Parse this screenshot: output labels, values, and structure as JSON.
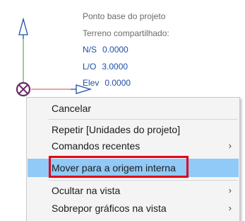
{
  "info": {
    "title": "Ponto base do projeto",
    "subtitle": "Terreno compartilhado:",
    "coords": [
      {
        "label": "N/S",
        "value": "0.0000"
      },
      {
        "label": "L/O",
        "value": "3.0000"
      },
      {
        "label": "Elev",
        "value": "0.0000"
      }
    ]
  },
  "menu": {
    "items": [
      {
        "label": "Cancelar",
        "submenu": false
      },
      {
        "label": "Repetir [Unidades do projeto]",
        "submenu": false
      },
      {
        "label": "Comandos recentes",
        "submenu": true
      },
      {
        "label": "Mover para a origem interna",
        "submenu": false,
        "hovered": true
      },
      {
        "label": "Ocultar na vista",
        "submenu": true
      },
      {
        "label": "Sobrepor gráficos na vista",
        "submenu": true
      }
    ],
    "submenu_glyph": "›"
  },
  "colors": {
    "y_axis": "#2e9e3a",
    "x_axis": "#e0414b",
    "arrow": "#1f4fa8",
    "base_point": "#6b2a64",
    "hover": "#91c9f7",
    "callout": "#e0001a"
  },
  "icons": [
    "y-arrow-icon",
    "x-arrow-icon",
    "base-point-icon",
    "submenu-chevron-icon"
  ]
}
